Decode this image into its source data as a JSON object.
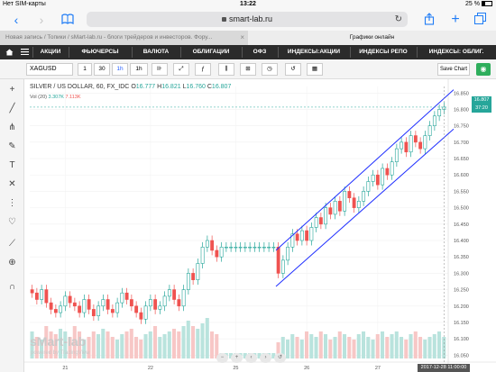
{
  "status": {
    "carrier": "Нет SIM-карты",
    "time": "13:22",
    "battery": "25 %"
  },
  "browser": {
    "url": "smart-lab.ru",
    "tabs": [
      {
        "label": "Новая запись / Топики / sMart-lab.ru - блоги трейдеров и инвесторов. Фору..."
      },
      {
        "label": "Графики онлайн"
      }
    ]
  },
  "nav": {
    "items": [
      "АКЦИИ",
      "ФЬЮЧЕРСЫ",
      "ВАЛЮТА",
      "ОБЛИГАЦИИ",
      "ОФЗ",
      "ИНДЕКСЫ:АКЦИИ",
      "ИНДЕКСЫ РЕПО",
      "ИНДЕКСЫ: ОБЛИГ."
    ]
  },
  "toolbar": {
    "symbol": "XAGUSD",
    "intervals": [
      "1",
      "30",
      "1h",
      "1h"
    ],
    "save_label": "Save Chart"
  },
  "chart": {
    "legend_title": "SILVER / US DOLLAR, 60, FX_IDC",
    "legend_o_label": "O",
    "legend_o": "16.777",
    "legend_h_label": "H",
    "legend_h": "16.821",
    "legend_l_label": "L",
    "legend_l": "16.760",
    "legend_c_label": "C",
    "legend_c": "16.807",
    "vol_label": "Vol (20)",
    "vol_1": "3.307K",
    "vol_2": "7.113K",
    "last_price": "16.807",
    "last_time": "37:20",
    "watermark": "sMart-lab",
    "powered": "powered by TradingView",
    "date_badge": "2017-12-28 11:00:00",
    "accent_up": "#26a69a",
    "accent_down": "#ef5350",
    "channel_color": "#1f2fff"
  },
  "chart_data": {
    "type": "candlestick",
    "title": "SILVER / US DOLLAR, 60, FX_IDC",
    "x_ticks": [
      "21",
      "22",
      "25",
      "26",
      "27"
    ],
    "y_ticks": [
      16.05,
      16.1,
      16.15,
      16.2,
      16.25,
      16.3,
      16.35,
      16.4,
      16.45,
      16.5,
      16.55,
      16.6,
      16.65,
      16.7,
      16.75,
      16.8,
      16.85
    ],
    "ylim": [
      16.04,
      16.87
    ],
    "price_path": [
      16.24,
      16.22,
      16.25,
      16.21,
      16.19,
      16.18,
      16.2,
      16.23,
      16.21,
      16.2,
      16.18,
      16.22,
      16.19,
      16.17,
      16.2,
      16.22,
      16.19,
      16.18,
      16.21,
      16.24,
      16.22,
      16.2,
      16.18,
      16.16,
      16.2,
      16.22,
      16.19,
      16.2,
      16.23,
      16.25,
      16.22,
      16.2,
      16.25,
      16.3,
      16.28,
      16.33,
      16.38,
      16.4,
      16.37,
      16.35,
      16.38,
      16.38,
      16.38,
      16.38,
      16.38,
      16.38,
      16.38,
      16.38,
      16.38,
      16.38,
      16.38,
      16.38,
      16.3,
      16.34,
      16.38,
      16.42,
      16.4,
      16.43,
      16.4,
      16.44,
      16.47,
      16.45,
      16.5,
      16.48,
      16.52,
      16.49,
      16.55,
      16.53,
      16.5,
      16.52,
      16.55,
      16.58,
      16.6,
      16.57,
      16.62,
      16.6,
      16.64,
      16.68,
      16.7,
      16.67,
      16.72,
      16.7,
      16.68,
      16.72,
      16.75,
      16.78,
      16.8,
      16.807
    ],
    "volume": [
      0.5,
      0.4,
      0.35,
      0.6,
      0.5,
      0.45,
      0.55,
      0.5,
      0.4,
      0.6,
      0.5,
      0.35,
      0.4,
      0.5,
      0.45,
      0.55,
      0.5,
      0.4,
      0.35,
      0.45,
      0.5,
      0.55,
      0.4,
      0.35,
      0.45,
      0.5,
      0.6,
      0.4,
      0.45,
      0.5,
      0.55,
      0.5,
      0.6,
      0.7,
      0.6,
      0.55,
      0.65,
      0.75,
      0.5,
      0.45,
      0.1,
      0.1,
      0.1,
      0.1,
      0.1,
      0.1,
      0.1,
      0.1,
      0.1,
      0.1,
      0.1,
      0.1,
      0.3,
      0.4,
      0.35,
      0.45,
      0.4,
      0.35,
      0.5,
      0.45,
      0.4,
      0.5,
      0.45,
      0.35,
      0.4,
      0.5,
      0.45,
      0.4,
      0.35,
      0.45,
      0.5,
      0.4,
      0.35,
      0.45,
      0.5,
      0.4,
      0.45,
      0.5,
      0.4,
      0.35,
      0.45,
      0.5,
      0.4,
      0.35,
      0.4,
      0.45,
      0.5,
      0.4
    ],
    "channel_upper": [
      [
        16.37,
        0
      ],
      [
        16.86,
        1
      ]
    ],
    "channel_lower": [
      [
        16.26,
        0
      ],
      [
        16.74,
        1
      ]
    ]
  }
}
